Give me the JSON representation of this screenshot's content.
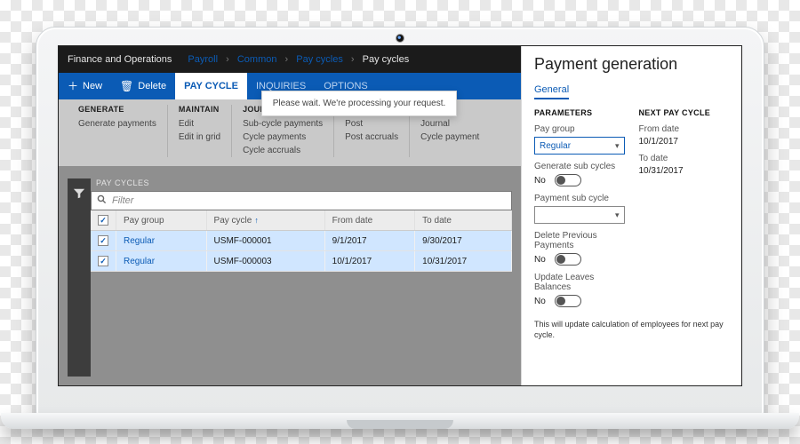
{
  "app_title": "Finance and Operations",
  "breadcrumb": [
    "Payroll",
    "Common",
    "Pay cycles",
    "Pay cycles"
  ],
  "commands": {
    "new": "New",
    "delete": "Delete",
    "paycycle": "PAY CYCLE",
    "inquiries": "INQUIRIES",
    "options": "OPTIONS"
  },
  "ribbon": {
    "generate": {
      "head": "GENERATE",
      "items": [
        "Generate payments"
      ]
    },
    "maintain": {
      "head": "MAINTAIN",
      "items": [
        "Edit",
        "Edit in grid"
      ]
    },
    "journals": {
      "head": "JOURNALS",
      "items": [
        "Sub-cycle payments",
        "Cycle payments",
        "Cycle accruals"
      ]
    },
    "post": {
      "head": "",
      "items": [
        "Post",
        "Post accruals"
      ]
    },
    "journal2": {
      "head": "",
      "items": [
        "Journal",
        "Cycle payment"
      ]
    }
  },
  "notice": {
    "msg": "Please wait. We're processing your request.",
    "sub": ""
  },
  "grid": {
    "title": "PAY CYCLES",
    "filter_placeholder": "Filter",
    "cols": [
      "Pay group",
      "Pay cycle",
      "From date",
      "To date"
    ],
    "rows": [
      {
        "selected": true,
        "paygroup": "Regular",
        "paycycle": "USMF-000001",
        "from": "9/1/2017",
        "to": "9/30/2017"
      },
      {
        "selected": true,
        "paygroup": "Regular",
        "paycycle": "USMF-000003",
        "from": "10/1/2017",
        "to": "10/31/2017"
      }
    ]
  },
  "panel": {
    "title": "Payment generation",
    "tab": "General",
    "parameters_head": "PARAMETERS",
    "nextcycle_head": "NEXT PAY CYCLE",
    "paygroup_label": "Pay group",
    "paygroup_value": "Regular",
    "gensub_label": "Generate sub cycles",
    "gensub_value": "No",
    "paysub_label": "Payment sub cycle",
    "paysub_value": "",
    "delprev_label": "Delete Previous Payments",
    "delprev_value": "No",
    "updleaves_label": "Update Leaves Balances",
    "updleaves_value": "No",
    "from_label": "From date",
    "from_value": "10/1/2017",
    "to_label": "To date",
    "to_value": "10/31/2017",
    "help": "This will update calculation of employees for next pay cycle."
  }
}
